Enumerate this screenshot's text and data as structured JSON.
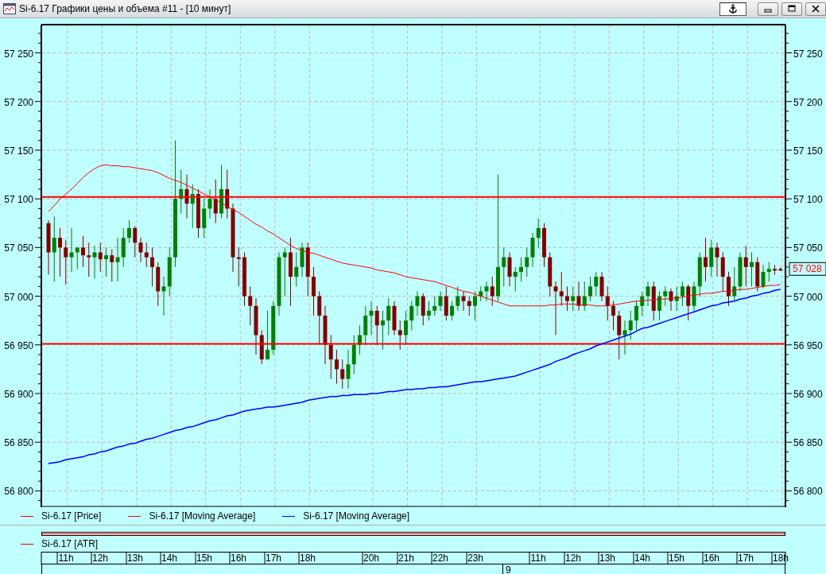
{
  "window": {
    "title": "Si-6.17 Графики цены и объема #11 - [10 минут]"
  },
  "price_chart": {
    "price_label": "57 028",
    "price_legend": {
      "label": "Si-6.17 [Price]",
      "color": "#ff0000"
    },
    "chart_data": {
      "type": "candlestick",
      "ylim": [
        56784,
        57279
      ],
      "grid": true,
      "yticks": [
        {
          "value": 57250,
          "label": "57 250"
        },
        {
          "value": 57200,
          "label": "57 200"
        },
        {
          "value": 57150,
          "label": "57 150"
        },
        {
          "value": 57100,
          "label": "57 100"
        },
        {
          "value": 57050,
          "label": "57 050"
        },
        {
          "value": 57000,
          "label": "57 000"
        },
        {
          "value": 56950,
          "label": "56 950"
        },
        {
          "value": 56900,
          "label": "56 900"
        },
        {
          "value": 56850,
          "label": "56 850"
        },
        {
          "value": 56800,
          "label": "56 800"
        }
      ],
      "categories": [
        null,
        null,
        null,
        "11h",
        null,
        null,
        null,
        null,
        null,
        "12h",
        null,
        null,
        null,
        null,
        null,
        "13h",
        null,
        null,
        null,
        null,
        null,
        "14h",
        null,
        null,
        null,
        null,
        null,
        "15h",
        null,
        null,
        null,
        null,
        null,
        "16h",
        null,
        null,
        null,
        null,
        null,
        "17h",
        null,
        null,
        null,
        null,
        null,
        "18h",
        null,
        null,
        null,
        null,
        null,
        null,
        null,
        null,
        null,
        null,
        "20h",
        null,
        null,
        null,
        null,
        null,
        "21h",
        null,
        null,
        null,
        null,
        null,
        "22h",
        null,
        null,
        null,
        null,
        null,
        "23h",
        null,
        null,
        null,
        null,
        null,
        null,
        null,
        null,
        null,
        null,
        "11h",
        null,
        null,
        null,
        null,
        null,
        "12h",
        null,
        null,
        null,
        null,
        null,
        "13h",
        null,
        null,
        null,
        null,
        null,
        "14h",
        null,
        null,
        null,
        null,
        null,
        "15h",
        null,
        null,
        null,
        null,
        null,
        "16h",
        null,
        null,
        null,
        null,
        null,
        "17h",
        null,
        null,
        null,
        null,
        null,
        "18h"
      ],
      "ohlc": [
        [
          57075,
          57078,
          57022,
          57045
        ],
        [
          57045,
          57082,
          57015,
          57060
        ],
        [
          57060,
          57070,
          57020,
          57050
        ],
        [
          57050,
          57058,
          57012,
          57040
        ],
        [
          57040,
          57070,
          57025,
          57045
        ],
        [
          57045,
          57050,
          57028,
          57050
        ],
        [
          57050,
          57062,
          57030,
          57042
        ],
        [
          57042,
          57055,
          57020,
          57040
        ],
        [
          57040,
          57052,
          57018,
          57045
        ],
        [
          57045,
          57055,
          57025,
          57038
        ],
        [
          57038,
          57050,
          57020,
          57042
        ],
        [
          57042,
          57048,
          57015,
          57035
        ],
        [
          57035,
          57060,
          57015,
          57040
        ],
        [
          57040,
          57070,
          57030,
          57060
        ],
        [
          57060,
          57078,
          57055,
          57070
        ],
        [
          57070,
          57072,
          57040,
          57055
        ],
        [
          57055,
          57060,
          57035,
          57045
        ],
        [
          57045,
          57055,
          57030,
          57040
        ],
        [
          57040,
          57050,
          57010,
          57030
        ],
        [
          57030,
          57035,
          56990,
          57005
        ],
        [
          57005,
          57020,
          56980,
          57010
        ],
        [
          57010,
          57050,
          57000,
          57040
        ],
        [
          57040,
          57160,
          57030,
          57100
        ],
        [
          57100,
          57130,
          57085,
          57110
        ],
        [
          57110,
          57125,
          57080,
          57095
        ],
        [
          57095,
          57115,
          57070,
          57105
        ],
        [
          57105,
          57110,
          57060,
          57070
        ],
        [
          57070,
          57100,
          57060,
          57090
        ],
        [
          57090,
          57110,
          57080,
          57100
        ],
        [
          57100,
          57120,
          57075,
          57085
        ],
        [
          57085,
          57135,
          57080,
          57110
        ],
        [
          57110,
          57130,
          57080,
          57090
        ],
        [
          57090,
          57095,
          57025,
          57040
        ],
        [
          57040,
          57050,
          57010,
          57040
        ],
        [
          57040,
          57045,
          56990,
          57000
        ],
        [
          57000,
          57010,
          56970,
          56990
        ],
        [
          56990,
          56998,
          56940,
          56960
        ],
        [
          56960,
          56965,
          56930,
          56935
        ],
        [
          56935,
          56985,
          56935,
          56945
        ],
        [
          56945,
          56995,
          56940,
          56990
        ],
        [
          56990,
          57045,
          56980,
          57040
        ],
        [
          57040,
          57050,
          57000,
          57045
        ],
        [
          57045,
          57060,
          56990,
          57020
        ],
        [
          57020,
          57045,
          57010,
          57030
        ],
        [
          57030,
          57055,
          57020,
          57050
        ],
        [
          57050,
          57055,
          57000,
          57020
        ],
        [
          57020,
          57030,
          56980,
          57000
        ],
        [
          57000,
          57005,
          56950,
          56980
        ],
        [
          56980,
          56990,
          56930,
          56950
        ],
        [
          56950,
          56960,
          56915,
          56935
        ],
        [
          56935,
          56945,
          56910,
          56925
        ],
        [
          56925,
          56935,
          56905,
          56915
        ],
        [
          56915,
          56945,
          56905,
          56930
        ],
        [
          56930,
          56960,
          56920,
          56950
        ],
        [
          56950,
          56970,
          56940,
          56960
        ],
        [
          56960,
          56990,
          56950,
          56980
        ],
        [
          56980,
          56995,
          56960,
          56985
        ],
        [
          56985,
          56990,
          56950,
          56970
        ],
        [
          56970,
          56985,
          56945,
          56975
        ],
        [
          56975,
          56998,
          56960,
          56990
        ],
        [
          56990,
          56995,
          56960,
          56965
        ],
        [
          56965,
          56975,
          56945,
          56960
        ],
        [
          56960,
          56985,
          56950,
          56975
        ],
        [
          56975,
          56995,
          56965,
          56990
        ],
        [
          56990,
          57005,
          56980,
          57000
        ],
        [
          57000,
          57003,
          56970,
          56980
        ],
        [
          56980,
          56995,
          56975,
          56985
        ],
        [
          56985,
          57000,
          56980,
          56990
        ],
        [
          56990,
          57005,
          56985,
          57000
        ],
        [
          57000,
          57010,
          56975,
          56980
        ],
        [
          56980,
          56995,
          56975,
          56990
        ],
        [
          56990,
          57010,
          56985,
          57000
        ],
        [
          57000,
          57005,
          56985,
          56995
        ],
        [
          56995,
          57000,
          56980,
          56990
        ],
        [
          56990,
          57005,
          56975,
          57000
        ],
        [
          57000,
          57010,
          56995,
          57005
        ],
        [
          57005,
          57015,
          56995,
          57010
        ],
        [
          57010,
          57020,
          56990,
          57000
        ],
        [
          57000,
          57125,
          56995,
          57030
        ],
        [
          57030,
          57050,
          57010,
          57040
        ],
        [
          57040,
          57045,
          57010,
          57020
        ],
        [
          57020,
          57030,
          57005,
          57025
        ],
        [
          57025,
          57040,
          57015,
          57030
        ],
        [
          57030,
          57050,
          57020,
          57040
        ],
        [
          57040,
          57065,
          57030,
          57060
        ],
        [
          57060,
          57080,
          57050,
          57070
        ],
        [
          57070,
          57075,
          57030,
          57040
        ],
        [
          57040,
          57045,
          57000,
          57010
        ],
        [
          57010,
          57015,
          56960,
          57005
        ],
        [
          57005,
          57025,
          56990,
          57000
        ],
        [
          57000,
          57010,
          56985,
          56995
        ],
        [
          56995,
          57010,
          56985,
          57000
        ],
        [
          57000,
          57015,
          56985,
          56990
        ],
        [
          56990,
          57015,
          56985,
          57000
        ],
        [
          57000,
          57020,
          56995,
          57010
        ],
        [
          57010,
          57025,
          57000,
          57020
        ],
        [
          57020,
          57025,
          56995,
          57000
        ],
        [
          57000,
          57010,
          56975,
          56990
        ],
        [
          56990,
          56995,
          56965,
          56980
        ],
        [
          56980,
          56985,
          56935,
          56960
        ],
        [
          56960,
          56975,
          56940,
          56965
        ],
        [
          56965,
          56985,
          56955,
          56975
        ],
        [
          56975,
          56995,
          56965,
          56990
        ],
        [
          56990,
          57005,
          56980,
          57000
        ],
        [
          57000,
          57015,
          56990,
          57010
        ],
        [
          57010,
          57015,
          56975,
          56985
        ],
        [
          56985,
          57005,
          56975,
          57000
        ],
        [
          57000,
          57010,
          56990,
          57005
        ],
        [
          57005,
          57008,
          56985,
          56995
        ],
        [
          56995,
          57010,
          56985,
          57000
        ],
        [
          57000,
          57015,
          56990,
          57010
        ],
        [
          57010,
          57012,
          56975,
          56990
        ],
        [
          56990,
          57015,
          56985,
          57010
        ],
        [
          57010,
          57045,
          57000,
          57040
        ],
        [
          57040,
          57060,
          57015,
          57030
        ],
        [
          57030,
          57058,
          57020,
          57050
        ],
        [
          57050,
          57055,
          57020,
          57040
        ],
        [
          57040,
          57045,
          57005,
          57020
        ],
        [
          57020,
          57025,
          56990,
          57000
        ],
        [
          57000,
          57030,
          56995,
          57010
        ],
        [
          57010,
          57045,
          57005,
          57040
        ],
        [
          57040,
          57052,
          57010,
          57030
        ],
        [
          57030,
          57045,
          57010,
          57035
        ],
        [
          57035,
          57040,
          57005,
          57010
        ],
        [
          57010,
          57032,
          57008,
          57025
        ],
        [
          57025,
          57035,
          57015,
          57028
        ],
        [
          57028,
          57032,
          57022,
          57028
        ],
        [
          57028,
          57030,
          57026,
          57028
        ]
      ]
    },
    "overlay_chart": {
      "chart_data": {
        "type": "line",
        "ylim": [
          56784,
          57279
        ],
        "yticks": [
          {
            "value": 57250,
            "label": "57 250"
          },
          {
            "value": 57200,
            "label": "57 200"
          },
          {
            "value": 57150,
            "label": "57 150"
          },
          {
            "value": 57100,
            "label": "57 100"
          },
          {
            "value": 57050,
            "label": "57 050"
          },
          {
            "value": 57000,
            "label": "57 000"
          },
          {
            "value": 56950,
            "label": "56 950"
          },
          {
            "value": 56900,
            "label": "56 900"
          },
          {
            "value": 56850,
            "label": "56 850"
          },
          {
            "value": 56800,
            "label": "56 800"
          }
        ],
        "categories": [
          null,
          null,
          null,
          null,
          null,
          null,
          null,
          null,
          null,
          null,
          null,
          null,
          null,
          null,
          null,
          null,
          null,
          null,
          null,
          null,
          null,
          null,
          null,
          null,
          null,
          null,
          null,
          null,
          null,
          null,
          null,
          null,
          null,
          null,
          null,
          null,
          null,
          null,
          null,
          null,
          null,
          null,
          null,
          null,
          null,
          null,
          null,
          null,
          null,
          null,
          null,
          null,
          null,
          null,
          null,
          null,
          null,
          null,
          null,
          null,
          null,
          null,
          null,
          null,
          null,
          null,
          null,
          null,
          null,
          null,
          null,
          null,
          null,
          null,
          null,
          null,
          null,
          null,
          null,
          null,
          null,
          null,
          null,
          null,
          null,
          null,
          null,
          null,
          null,
          null,
          null,
          null,
          null,
          null,
          null,
          null,
          null,
          null,
          null,
          null,
          null,
          null,
          null,
          null,
          null,
          null,
          null,
          null,
          null,
          null,
          null,
          null,
          null,
          null,
          null,
          null,
          null,
          null,
          null,
          null,
          null,
          null,
          null,
          null,
          null,
          null,
          null,
          null
        ],
        "series": [
          {
            "name": "Si-6.17 [Moving Average]",
            "color": "#ff0000",
            "values": [
              57087,
              57093,
              57100,
              57105,
              57110,
              57116,
              57122,
              57127,
              57131,
              57134,
              57135,
              57134,
              57134,
              57133,
              57133,
              57132,
              57131,
              57130,
              57129,
              57127,
              57124,
              57121,
              57119,
              57117,
              57114,
              57111,
              57108,
              57105,
              57102,
              57099,
              57096,
              57092,
              57089,
              57086,
              57082,
              57078,
              57074,
              57071,
              57067,
              57064,
              57060,
              57056,
              57052,
              57049,
              57047,
              57045,
              57044,
              57042,
              57040,
              57038,
              57036,
              57034,
              57033,
              57032,
              57031,
              57030,
              57029,
              57027,
              57026,
              57025,
              57024,
              57022,
              57020,
              57019,
              57018,
              57017,
              57016,
              57015,
              57013,
              57011,
              57009,
              57007,
              57005,
              57004,
              57002,
              57000,
              56998,
              56996,
              56994,
              56992,
              56990,
              56990,
              56990,
              56990,
              56990,
              56990,
              56990,
              56991,
              56991,
              56992,
              56992,
              56992,
              56991,
              56991,
              56991,
              56990,
              56990,
              56990,
              56991,
              56992,
              56993,
              56994,
              56995,
              56995,
              56996,
              56996,
              56997,
              56997,
              56998,
              56998,
              56999,
              57000,
              57001,
              57002,
              57003,
              57003,
              57004,
              57005,
              57005,
              57006,
              57007,
              57007,
              57008,
              57009,
              57010,
              57011,
              57011,
              57012
            ]
          },
          {
            "name": "Si-6.17 [Moving Average]",
            "color": "#0000ff",
            "values": [
              56828,
              56829,
              56830,
              56832,
              56833,
              56834,
              56835,
              56837,
              56838,
              56840,
              56841,
              56843,
              56845,
              56846,
              56848,
              56849,
              56851,
              56853,
              56854,
              56856,
              56858,
              56860,
              56862,
              56863,
              56865,
              56866,
              56868,
              56870,
              56872,
              56873,
              56875,
              56877,
              56878,
              56880,
              56882,
              56883,
              56884,
              56885,
              56886,
              56886,
              56887,
              56888,
              56889,
              56890,
              56891,
              56893,
              56894,
              56895,
              56896,
              56897,
              56897,
              56898,
              56898,
              56899,
              56899,
              56899,
              56900,
              56900,
              56901,
              56902,
              56902,
              56903,
              56904,
              56904,
              56905,
              56905,
              56906,
              56906,
              56907,
              56907,
              56908,
              56909,
              56910,
              56911,
              56912,
              56912,
              56913,
              56914,
              56915,
              56916,
              56917,
              56918,
              56920,
              56922,
              56924,
              56926,
              56928,
              56930,
              56933,
              56935,
              56937,
              56940,
              56942,
              56944,
              56946,
              56949,
              56951,
              56953,
              56955,
              56957,
              56959,
              56961,
              56964,
              56967,
              56968,
              56970,
              56972,
              56974,
              56976,
              56978,
              56980,
              56982,
              56984,
              56986,
              56988,
              56990,
              56991,
              56993,
              56994,
              56995,
              56997,
              56998,
              57000,
              57001,
              57003,
              57004,
              57006,
              57007
            ]
          }
        ],
        "ref_lines": [
          {
            "axis": "y",
            "value": 57102,
            "color": "#ff0000"
          },
          {
            "axis": "y",
            "value": 56951,
            "color": "#ff0000"
          }
        ]
      }
    }
  },
  "atr_panel": {
    "legend": [
      {
        "label": "Si-6.17 [ATR]",
        "color": "#ff0000"
      }
    ]
  },
  "time_axis": {
    "date": "9"
  }
}
